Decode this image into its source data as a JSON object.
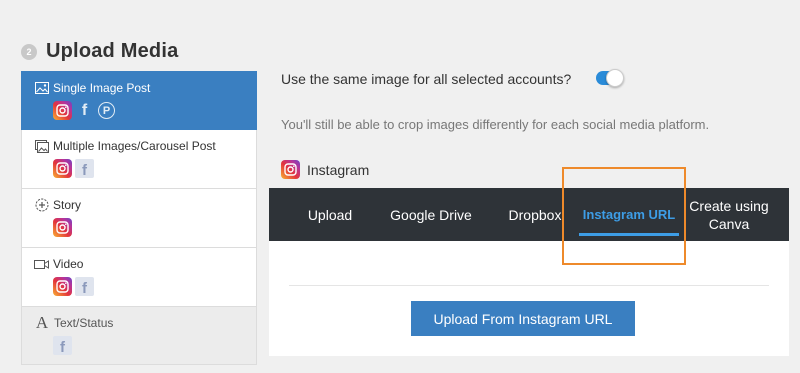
{
  "section": {
    "step": "2",
    "title": "Upload Media"
  },
  "post_types": [
    {
      "label": "Single Image Post",
      "icon": "image-icon",
      "active": true,
      "platforms": [
        "instagram",
        "facebook",
        "pinterest"
      ]
    },
    {
      "label": "Multiple Images/Carousel Post",
      "icon": "images-icon",
      "active": false,
      "platforms": [
        "instagram",
        "facebook"
      ]
    },
    {
      "label": "Story",
      "icon": "story-plus-icon",
      "active": false,
      "platforms": [
        "instagram"
      ]
    },
    {
      "label": "Video",
      "icon": "video-icon",
      "active": false,
      "platforms": [
        "instagram",
        "facebook"
      ]
    },
    {
      "label": "Text/Status",
      "icon": "text-icon",
      "active": false,
      "disabled": true,
      "platforms": [
        "facebook"
      ]
    }
  ],
  "same_image": {
    "label": "Use the same image for all selected accounts?",
    "enabled": true
  },
  "crop_note": "You'll still be able to crop images differently for each social media platform.",
  "platform": {
    "name": "Instagram",
    "icon": "instagram-icon"
  },
  "tabs": [
    {
      "label": "Upload"
    },
    {
      "label": "Google Drive"
    },
    {
      "label": "Dropbox"
    },
    {
      "label": "Instagram URL",
      "active": true
    },
    {
      "label": "Create using Canva"
    }
  ],
  "upload_button": "Upload From Instagram URL",
  "colors": {
    "accent": "#3a7fc1",
    "tab_bar": "#2e3338",
    "active_tab": "#3d9de6",
    "highlight": "#ee8a2b"
  }
}
